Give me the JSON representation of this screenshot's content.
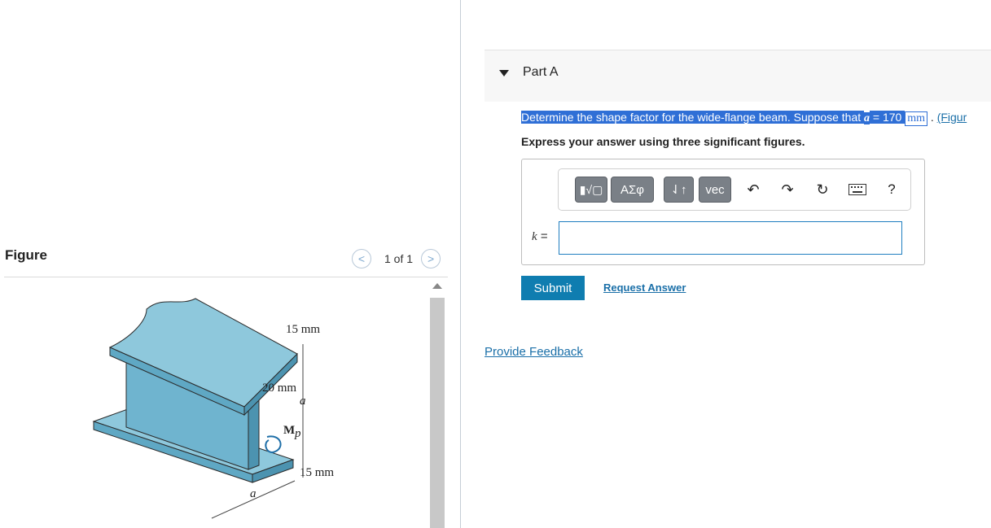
{
  "figure_panel": {
    "label": "Figure",
    "pager_prev": "<",
    "pager_count": "1 of 1",
    "pager_next": ">",
    "dims": {
      "top_flange": "15 mm",
      "web": "20 mm",
      "a_right": "a",
      "moment": "M",
      "moment_sub": "p",
      "bottom_flange": "15 mm",
      "a_bottom": "a"
    }
  },
  "part": {
    "title": "Part A",
    "question_prefix": "Determine the shape factor for the wide-flange beam. Suppose that ",
    "question_var": "a",
    "question_value": " = 170 ",
    "question_unit": "mm",
    "question_suffix": " . ",
    "figure_link": "(Figur",
    "instruction": "Express your answer using three significant figures."
  },
  "toolbar": {
    "templates_label": "▮√▢",
    "greek_label": "ΑΣφ",
    "arrows_label": "⇃↑",
    "vec_label": "vec",
    "help_label": "?"
  },
  "answer": {
    "variable": "k",
    "equals": " =",
    "value": ""
  },
  "actions": {
    "submit": "Submit",
    "request_answer": "Request Answer",
    "provide_feedback": "Provide Feedback"
  },
  "colors": {
    "beam_face": "#8ec8dc",
    "beam_edge": "#2a2a2a",
    "accent": "#0f7db0",
    "highlight": "#2f6fd6"
  }
}
